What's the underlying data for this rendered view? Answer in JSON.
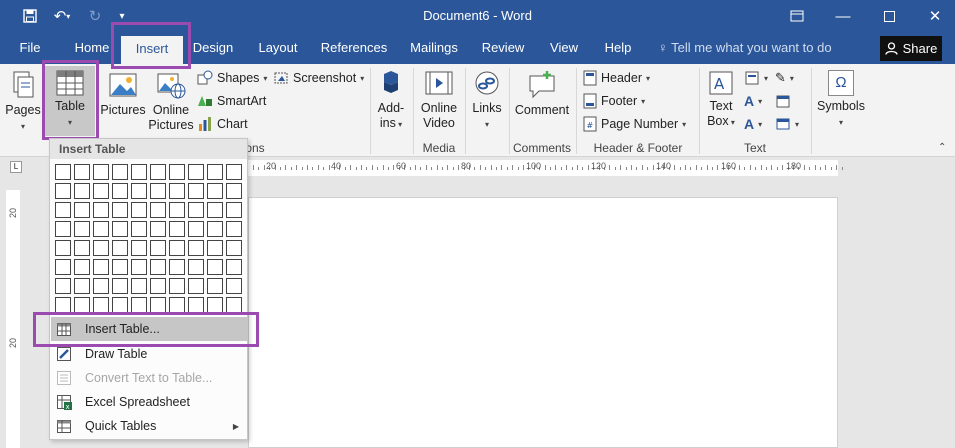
{
  "window": {
    "title": "Document6  -  Word"
  },
  "tabs": [
    "File",
    "Home",
    "Insert",
    "Design",
    "Layout",
    "References",
    "Mailings",
    "Review",
    "View",
    "Help"
  ],
  "active_tab": "Insert",
  "tell_me": "Tell me what you want to do",
  "share_label": "Share",
  "ribbon": {
    "pages": "Pages",
    "table": "Table",
    "pictures": "Pictures",
    "online_pictures_1": "Online",
    "online_pictures_2": "Pictures",
    "shapes": "Shapes",
    "smartart": "SmartArt",
    "chart": "Chart",
    "screenshot": "Screenshot",
    "illustrations_suffix": "ons",
    "addins_1": "Add-",
    "addins_2": "ins",
    "online_video_1": "Online",
    "online_video_2": "Video",
    "media_group": "Media",
    "links": "Links",
    "comment": "Comment",
    "comments_group": "Comments",
    "header": "Header",
    "footer": "Footer",
    "page_number": "Page Number",
    "header_footer_group": "Header & Footer",
    "text_box_1": "Text",
    "text_box_2": "Box",
    "text_group": "Text",
    "symbols": "Symbols"
  },
  "ruler": {
    "marks": [
      "20",
      "40",
      "60",
      "80",
      "100",
      "120",
      "140",
      "160",
      "180"
    ],
    "v_marks": [
      "20",
      "20"
    ]
  },
  "dropdown": {
    "header": "Insert Table",
    "grid_cols": 10,
    "grid_rows": 8,
    "items": [
      {
        "label": "Insert Table...",
        "hover": true,
        "disabled": false
      },
      {
        "label": "Draw Table",
        "hover": false,
        "disabled": false
      },
      {
        "label": "Convert Text to Table...",
        "hover": false,
        "disabled": true
      },
      {
        "label": "Excel Spreadsheet",
        "hover": false,
        "disabled": false
      },
      {
        "label": "Quick Tables",
        "hover": false,
        "disabled": false
      }
    ]
  },
  "colors": {
    "accent": "#2b579a",
    "highlight": "#9b4bb0"
  }
}
